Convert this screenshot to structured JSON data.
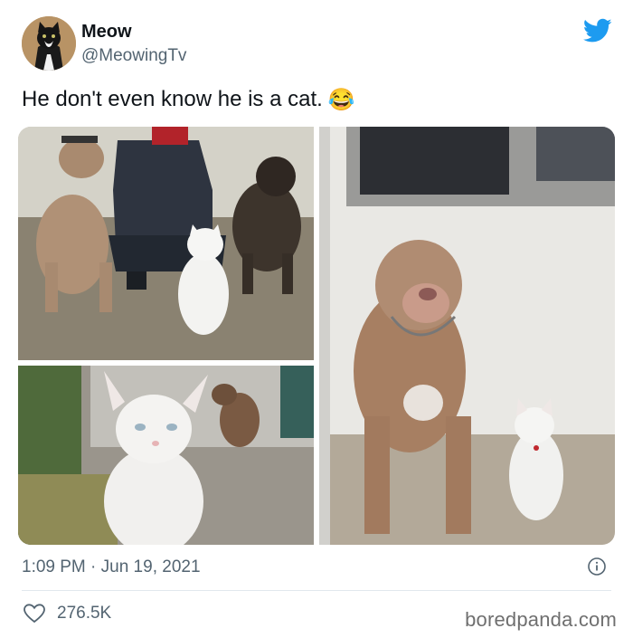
{
  "tweet": {
    "author_name": "Meow",
    "author_handle": "@MeowingTv",
    "text": "He don't even know he is a cat.",
    "emoji": "😂",
    "timestamp": "1:09 PM · Jun 19, 2021",
    "likes": "276.5K"
  },
  "watermark": "boredpanda.com",
  "icons": {
    "avatar": "cat-avatar",
    "bird": "twitter-bird-icon",
    "info": "info-icon",
    "heart": "heart-icon"
  },
  "colors": {
    "twitter_blue": "#1d9bf0",
    "secondary_text": "#536471",
    "divider": "#e1e8ed"
  }
}
